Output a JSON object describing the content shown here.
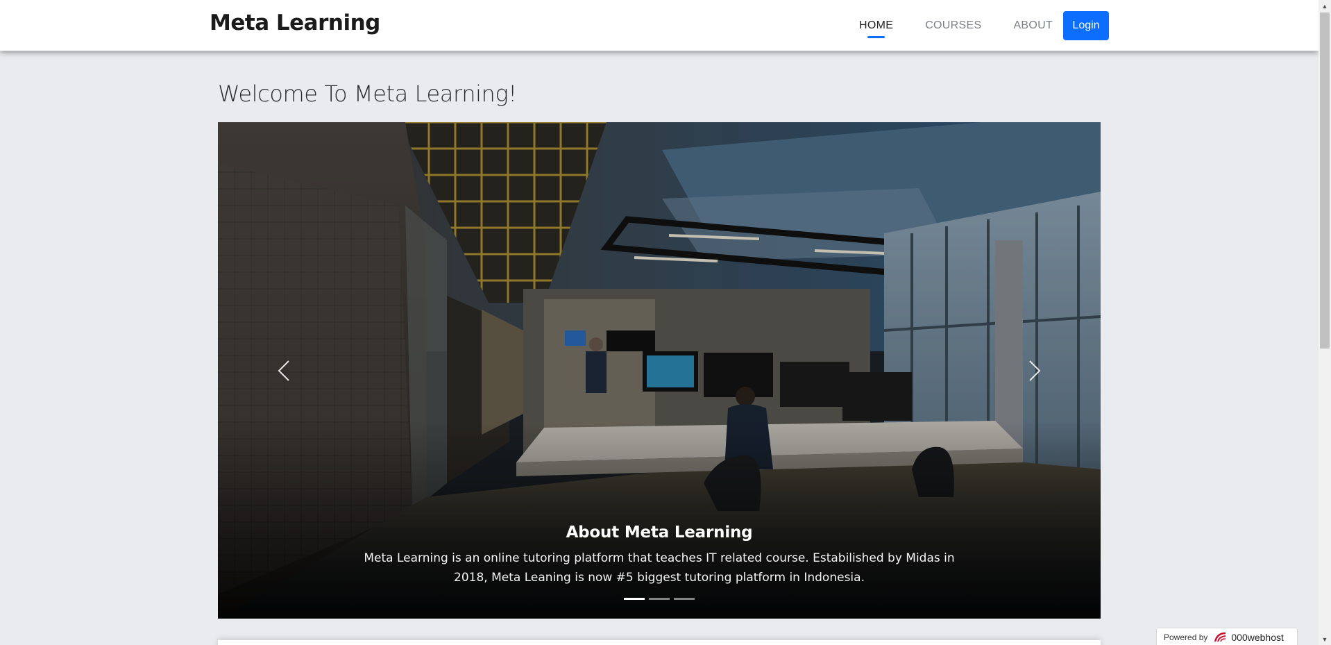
{
  "navbar": {
    "brand": "Meta Learning",
    "links": [
      {
        "label": "HOME",
        "active": true
      },
      {
        "label": "COURSES",
        "active": false
      },
      {
        "label": "ABOUT",
        "active": false
      }
    ],
    "login_label": "Login"
  },
  "page": {
    "title": "Welcome To Meta Learning!"
  },
  "carousel": {
    "caption_title_prefix": "About",
    "caption_title_bold": "Meta Learning",
    "caption_text": "Meta Learning is an online tutoring platform that teaches IT related course. Estabilished by Midas in 2018, Meta Leaning is now #5 biggest tutoring platform in Indonesia.",
    "slide_count": 3,
    "active_slide": 1,
    "prev_icon": "chevron-left-icon",
    "next_icon": "chevron-right-icon"
  },
  "badge": {
    "powered_by": "Powered by",
    "host_name": "000webhost"
  },
  "colors": {
    "accent": "#0d6efd",
    "background": "#e9ebef",
    "navbar": "#ffffff"
  }
}
